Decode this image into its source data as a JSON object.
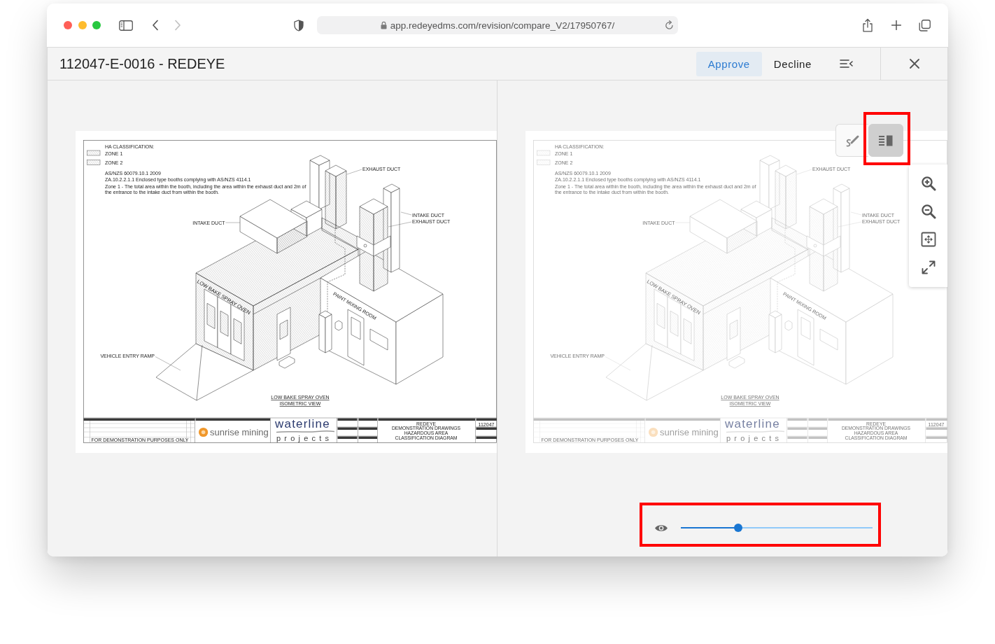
{
  "window_controls": [
    {
      "color": "#ff5f57"
    },
    {
      "color": "#febc2e"
    },
    {
      "color": "#28c840"
    }
  ],
  "navigation": [
    {
      "kind": "back",
      "disabled": false
    },
    {
      "kind": "forward",
      "disabled": true
    }
  ],
  "address_bar": {
    "url": "app.redeyedms.com/revision/compare_V2/17950767/"
  },
  "header": {
    "title": "112047-E-0016 - REDEYE",
    "actions": [
      {
        "label": "Approve",
        "kind": "primary"
      },
      {
        "label": "Decline",
        "kind": "plain"
      }
    ]
  },
  "sheets": [
    {
      "legend_title": "HA CLASSIFICATION:",
      "zones": [
        "ZONE 1",
        "ZONE 2"
      ],
      "standard": "AS/NZS 60079.10.1 2009",
      "clause": "ZA.10.2.2.1.1 Enclosed type booths complying with AS/NZS 4114.1",
      "zone_note": "Zone 1 - The total area within the booth, including the area within the exhaust duct and 2m of the entrance to the intake duct from within the booth.",
      "callouts": [
        "INTAKE DUCT",
        "EXHAUST DUCT",
        "INTAKE DUCT",
        "EXHAUST DUCT",
        "VEHICLE ENTRY RAMP"
      ],
      "building_labels": [
        "LOW BAKE SPRAY OVEN",
        "PAINT MIXING ROOM"
      ],
      "view_title": [
        "LOW BAKE SPRAY OVEN",
        "ISOMETRIC VIEW"
      ],
      "revision_note": "FOR DEMONSTRATION PURPOSES ONLY",
      "client_logo": "sunrise mining",
      "firm_logo": [
        "waterline",
        "projects"
      ],
      "drawing_title": [
        "REDEYE",
        "DEMONSTRATION DRAWINGS",
        "HAZARDOUS AREA",
        "CLASSIFICATION DIAGRAM"
      ],
      "job_number": "112047"
    },
    {
      "legend_title": "HA CLASSIFICATION:",
      "zones": [
        "ZONE 1",
        "ZONE 2"
      ],
      "standard": "AS/NZS 60079.10.1 2009",
      "clause": "ZA.10.2.2.1.1 Enclosed type booths complying with AS/NZS 4114.1",
      "zone_note": "Zone 1 - The total area within the booth, including the area within the exhaust duct and 2m of the entrance to the intake duct from within the booth.",
      "callouts": [
        "INTAKE DUCT",
        "EXHAUST DUCT",
        "INTAKE DUCT",
        "EXHAUST DUCT",
        "VEHICLE ENTRY RAMP"
      ],
      "building_labels": [
        "LOW BAKE SPRAY OVEN",
        "PAINT MIXING ROOM"
      ],
      "view_title": [
        "LOW BAKE SPRAY OVEN",
        "ISOMETRIC VIEW"
      ],
      "revision_note": "FOR DEMONSTRATION PURPOSES ONLY",
      "client_logo": "sunrise mining",
      "firm_logo": [
        "waterline",
        "projects"
      ],
      "drawing_title": [
        "REDEYE",
        "DEMONSTRATION DRAWINGS",
        "HAZARDOUS AREA",
        "CLASSIFICATION DIAGRAM"
      ],
      "job_number": "112047"
    }
  ],
  "view_modes": [
    {
      "kind": "markup",
      "selected": false,
      "highlighted": false
    },
    {
      "kind": "compare",
      "selected": true,
      "highlighted": true
    }
  ],
  "opacity_slider": {
    "level": 0.3,
    "highlighted": true
  }
}
